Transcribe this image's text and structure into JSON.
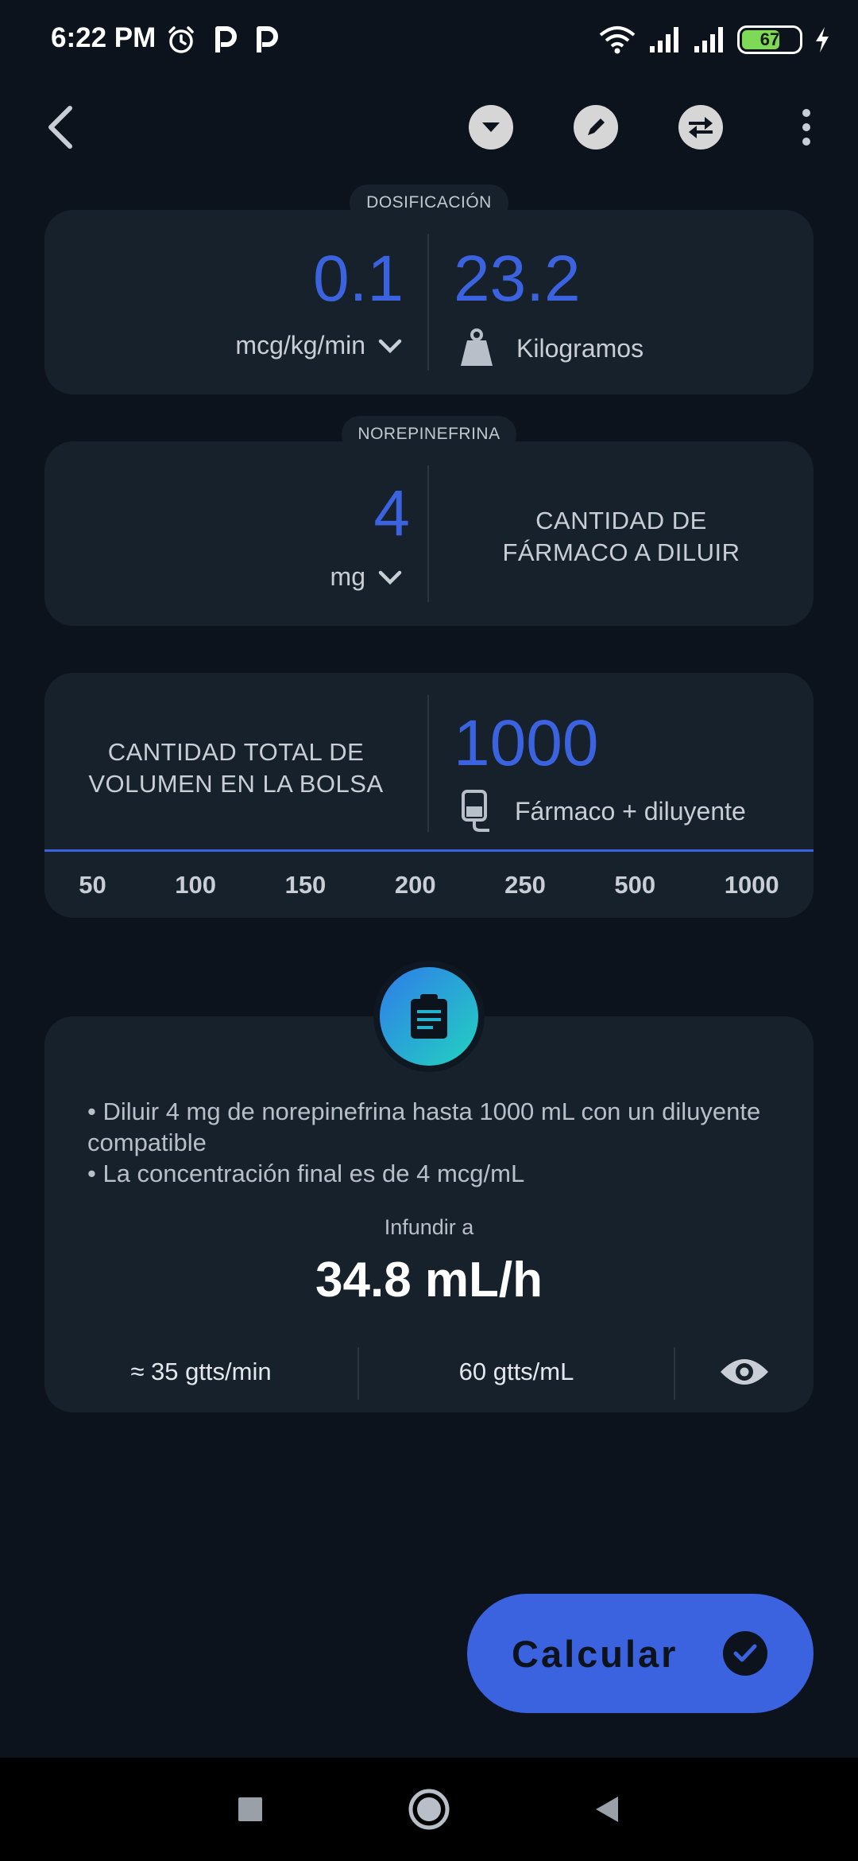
{
  "status_bar": {
    "time": "6:22 PM",
    "battery_level": "67",
    "battery_fraction": 0.67
  },
  "dosificacion": {
    "tag": "DOSIFICACIÓN",
    "dose_value": "0.1",
    "dose_unit": "mcg/kg/min",
    "weight_value": "23.2",
    "weight_unit": "Kilogramos"
  },
  "farmaco": {
    "tag": "NOREPINEFRINA",
    "amount_value": "4",
    "amount_unit": "mg",
    "label_line1": "CANTIDAD DE",
    "label_line2": "FÁRMACO A DILUIR"
  },
  "volumen": {
    "label_line1": "CANTIDAD TOTAL DE",
    "label_line2": "VOLUMEN EN LA BOLSA",
    "value": "1000",
    "unit": "Fármaco + diluyente",
    "presets": [
      "50",
      "100",
      "150",
      "200",
      "250",
      "500",
      "1000"
    ]
  },
  "resultado": {
    "bullet1": "• Diluir 4 mg de norepinefrina hasta 1000 mL con un diluyente compatible",
    "bullet2": "• La concentración final es de 4 mcg/mL",
    "infundir_label": "Infundir a",
    "rate": "34.8 mL/h",
    "drops_per_min": "≈ 35 gtts/min",
    "drop_factor": "60 gtts/mL"
  },
  "calcular_label": "Calcular",
  "colors": {
    "accent": "#3b63e0",
    "background": "#0d131c",
    "card": "#17212b"
  }
}
